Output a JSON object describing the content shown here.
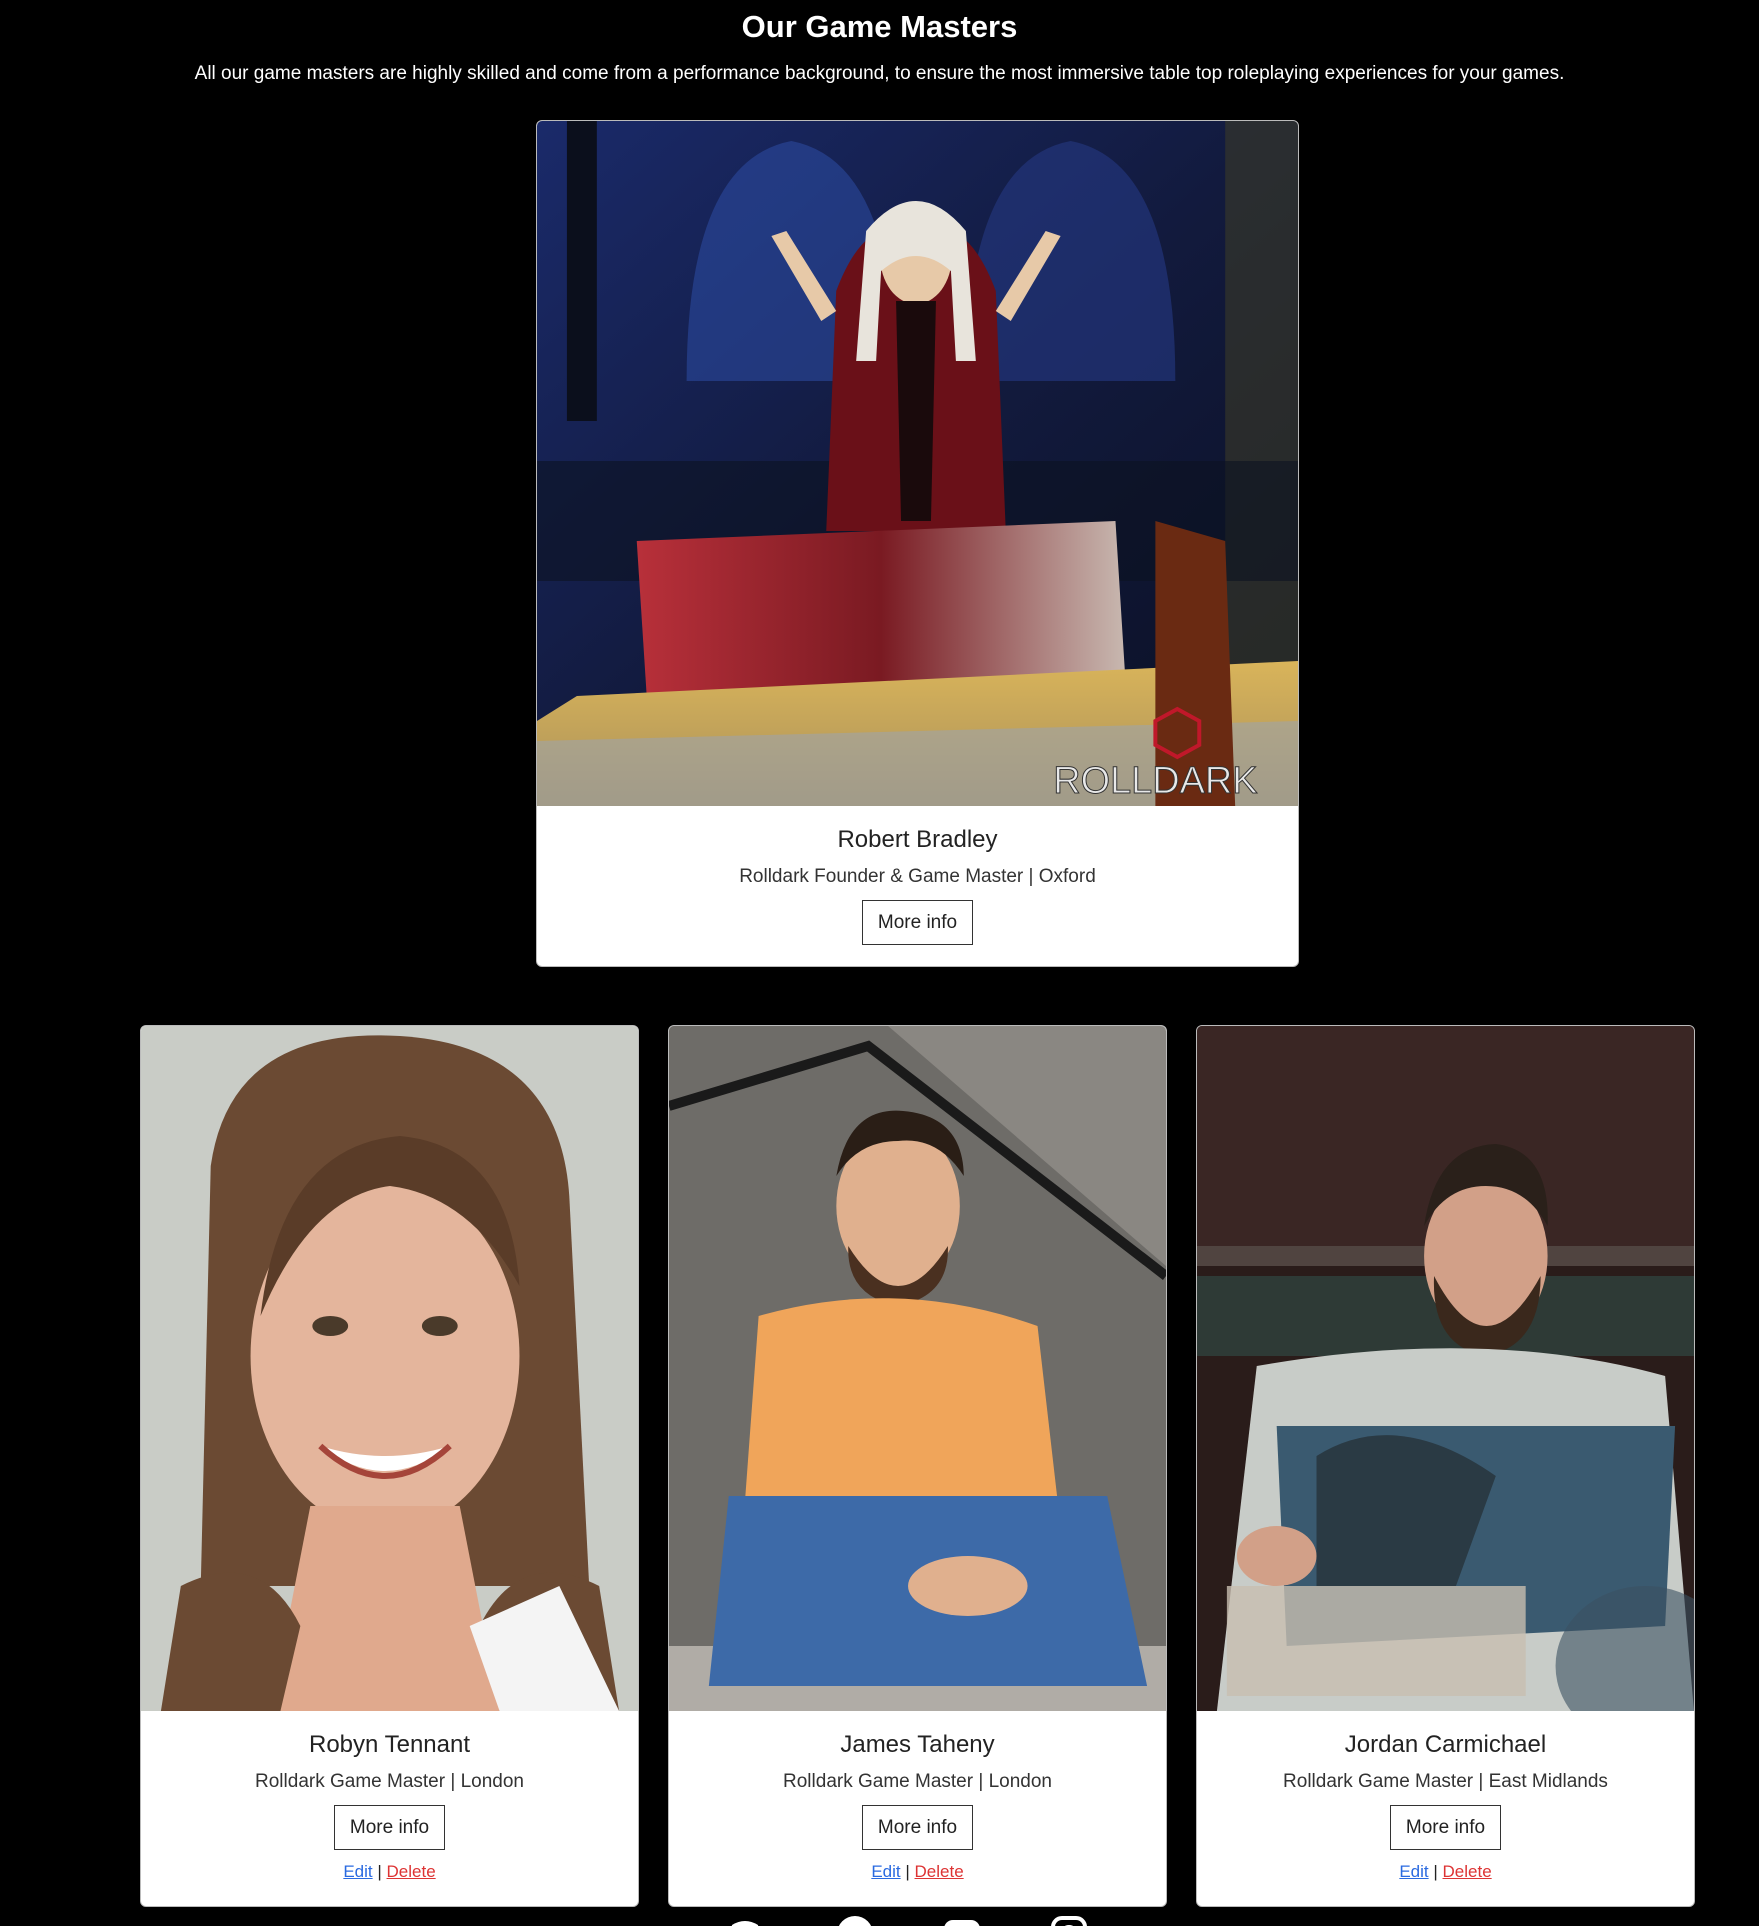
{
  "header": {
    "title": "Our Game Masters",
    "subtitle": "All our game masters are highly skilled and come from a performance background, to ensure the most immersive table top roleplaying experiences for your games."
  },
  "featured": {
    "name": "Robert Bradley",
    "role": "Rolldark Founder & Game Master | Oxford",
    "button": "More info",
    "watermark": "ROLLDARK"
  },
  "masters": [
    {
      "name": "Robyn Tennant",
      "role": "Rolldark Game Master | London",
      "button": "More info",
      "edit": "Edit",
      "delete": "Delete"
    },
    {
      "name": "James Taheny",
      "role": "Rolldark Game Master | London",
      "button": "More info",
      "edit": "Edit",
      "delete": "Delete"
    },
    {
      "name": "Jordan Carmichael",
      "role": "Rolldark Game Master | East Midlands",
      "button": "More info",
      "edit": "Edit",
      "delete": "Delete"
    }
  ],
  "separator": "|",
  "social": {
    "icons": [
      "discord-icon",
      "facebook-icon",
      "youtube-icon",
      "instagram-icon"
    ]
  },
  "colors": {
    "background": "#000000",
    "card": "#ffffff",
    "edit_link": "#2a6ae0",
    "delete_link": "#dd3333"
  }
}
